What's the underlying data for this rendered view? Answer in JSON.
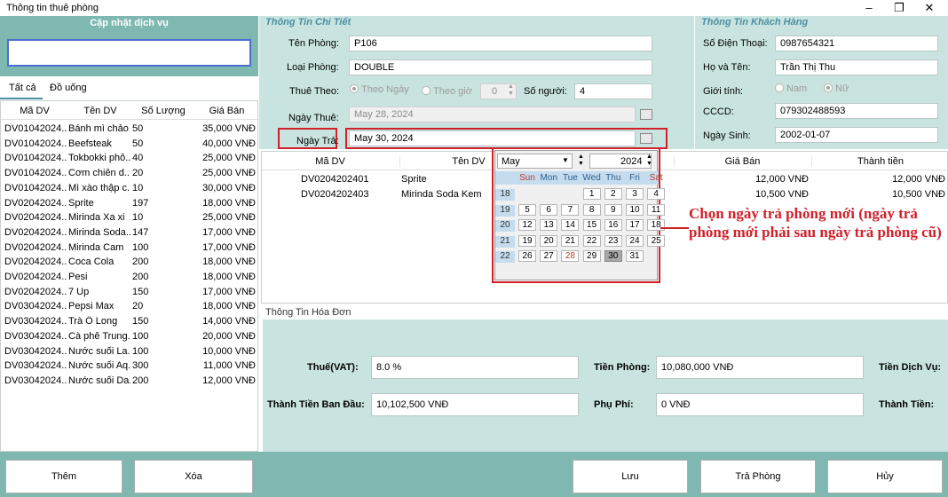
{
  "window": {
    "title": "Thông tin thuê phòng"
  },
  "service_panel": {
    "title": "Cập nhật dịch vụ",
    "search_value": "",
    "tabs": [
      "Tất cả",
      "Đồ uống"
    ],
    "headers": [
      "Mã DV",
      "Tên DV",
      "Số Lượng",
      "Giá Bán"
    ],
    "rows": [
      [
        "DV01042024...",
        "Bánh mì chảo",
        "50",
        "35,000 VNĐ"
      ],
      [
        "DV01042024...",
        "Beefsteak",
        "50",
        "40,000 VNĐ"
      ],
      [
        "DV01042024...",
        "Tokbokki phô...",
        "40",
        "25,000 VNĐ"
      ],
      [
        "DV01042024...",
        "Cơm chiên d...",
        "20",
        "25,000 VNĐ"
      ],
      [
        "DV01042024...",
        "Mì xào thập c...",
        "10",
        "30,000 VNĐ"
      ],
      [
        "DV02042024...",
        "Sprite",
        "197",
        "18,000 VNĐ"
      ],
      [
        "DV02042024...",
        "Mirinda Xa xi",
        "10",
        "25,000 VNĐ"
      ],
      [
        "DV02042024...",
        "Mirinda Soda...",
        "147",
        "17,000 VNĐ"
      ],
      [
        "DV02042024...",
        "Mirinda Cam",
        "100",
        "17,000 VNĐ"
      ],
      [
        "DV02042024...",
        "Coca Cola",
        "200",
        "18,000 VNĐ"
      ],
      [
        "DV02042024...",
        "Pesi",
        "200",
        "18,000 VNĐ"
      ],
      [
        "DV02042024...",
        "7 Up",
        "150",
        "17,000 VNĐ"
      ],
      [
        "DV03042024...",
        "Pepsi Max",
        "20",
        "18,000 VNĐ"
      ],
      [
        "DV03042024...",
        "Trà Ô Long",
        "150",
        "14,000 VNĐ"
      ],
      [
        "DV03042024...",
        "Cà phê Trung...",
        "100",
        "20,000 VNĐ"
      ],
      [
        "DV03042024...",
        "Nước suối La...",
        "100",
        "10,000 VNĐ"
      ],
      [
        "DV03042024...",
        "Nước suối Aq...",
        "300",
        "11,000 VNĐ"
      ],
      [
        "DV03042024...",
        "Nước suối Da...",
        "200",
        "12,000 VNĐ"
      ]
    ]
  },
  "detail": {
    "title": "Thông Tin Chi Tiết",
    "room_label": "Tên Phòng:",
    "room_value": "P106",
    "type_label": "Loại Phòng:",
    "type_value": "DOUBLE",
    "rent_by_label": "Thuê Theo:",
    "by_day": "Theo Ngày",
    "by_hour": "Theo giờ",
    "hour_value": "0",
    "people_label": "Số người:",
    "people_value": "4",
    "checkin_label": "Ngày Thuê:",
    "checkin_value": "May 28, 2024",
    "checkout_label": "Ngày Trả:",
    "checkout_value": "May 30, 2024"
  },
  "customer": {
    "title": "Thông Tin Khách Hàng",
    "phone_label": "Số Điện Thoại:",
    "phone_value": "0987654321",
    "name_label": "Họ và Tên:",
    "name_value": "Trần Thị Thu",
    "gender_label": "Giới tính:",
    "male": "Nam",
    "female": "Nữ",
    "id_label": "CCCD:",
    "id_value": "079302488593",
    "dob_label": "Ngày Sinh:",
    "dob_value": "2002-01-07"
  },
  "used_services": {
    "headers": [
      "Mã DV",
      "Tên DV",
      "Giá Bán",
      "Thành tiền"
    ],
    "rows": [
      [
        "DV0204202401",
        "Sprite",
        "12,000 VNĐ",
        "12,000 VNĐ"
      ],
      [
        "DV0204202403",
        "Mirinda Soda Kem",
        "10,500 VNĐ",
        "10,500 VNĐ"
      ]
    ]
  },
  "calendar": {
    "month": "May",
    "year": "2024",
    "weekdays": [
      "Sun",
      "Mon",
      "Tue",
      "Wed",
      "Thu",
      "Fri",
      "Sat"
    ],
    "weeks": [
      {
        "wk": "18",
        "days": [
          "",
          "",
          "",
          "1",
          "2",
          "3",
          "4"
        ]
      },
      {
        "wk": "19",
        "days": [
          "5",
          "6",
          "7",
          "8",
          "9",
          "10",
          "11"
        ]
      },
      {
        "wk": "20",
        "days": [
          "12",
          "13",
          "14",
          "15",
          "16",
          "17",
          "18"
        ]
      },
      {
        "wk": "21",
        "days": [
          "19",
          "20",
          "21",
          "22",
          "23",
          "24",
          "25"
        ]
      },
      {
        "wk": "22",
        "days": [
          "26",
          "27",
          "28",
          "29",
          "30",
          "31",
          ""
        ]
      }
    ],
    "selected": "30",
    "highlight": "28"
  },
  "annotation": "Chọn ngày trả phòng mới (ngày trả phòng mới phải sau ngày trả phòng cũ)",
  "invoice": {
    "title": "Thông Tin Hóa Đơn",
    "vat_label": "Thuế(VAT):",
    "vat_value": "8.0 %",
    "room_fee_label": "Tiền Phòng:",
    "room_fee_value": "10,080,000 VNĐ",
    "service_fee_label": "Tiền Dịch Vụ:",
    "base_total_label": "Thành Tiền Ban Đầu:",
    "base_total_value": "10,102,500 VNĐ",
    "surcharge_label": "Phụ Phí:",
    "surcharge_value": "0 VNĐ",
    "total_label": "Thành Tiền:"
  },
  "buttons": {
    "add": "Thêm",
    "delete": "Xóa",
    "save": "Lưu",
    "checkout": "Trả Phòng",
    "cancel": "Hủy"
  },
  "colors": {
    "panel": "#c9e4e0",
    "teal": "#7eb8b0",
    "section_title": "#4b8fa0",
    "annotation": "#d0202a"
  }
}
